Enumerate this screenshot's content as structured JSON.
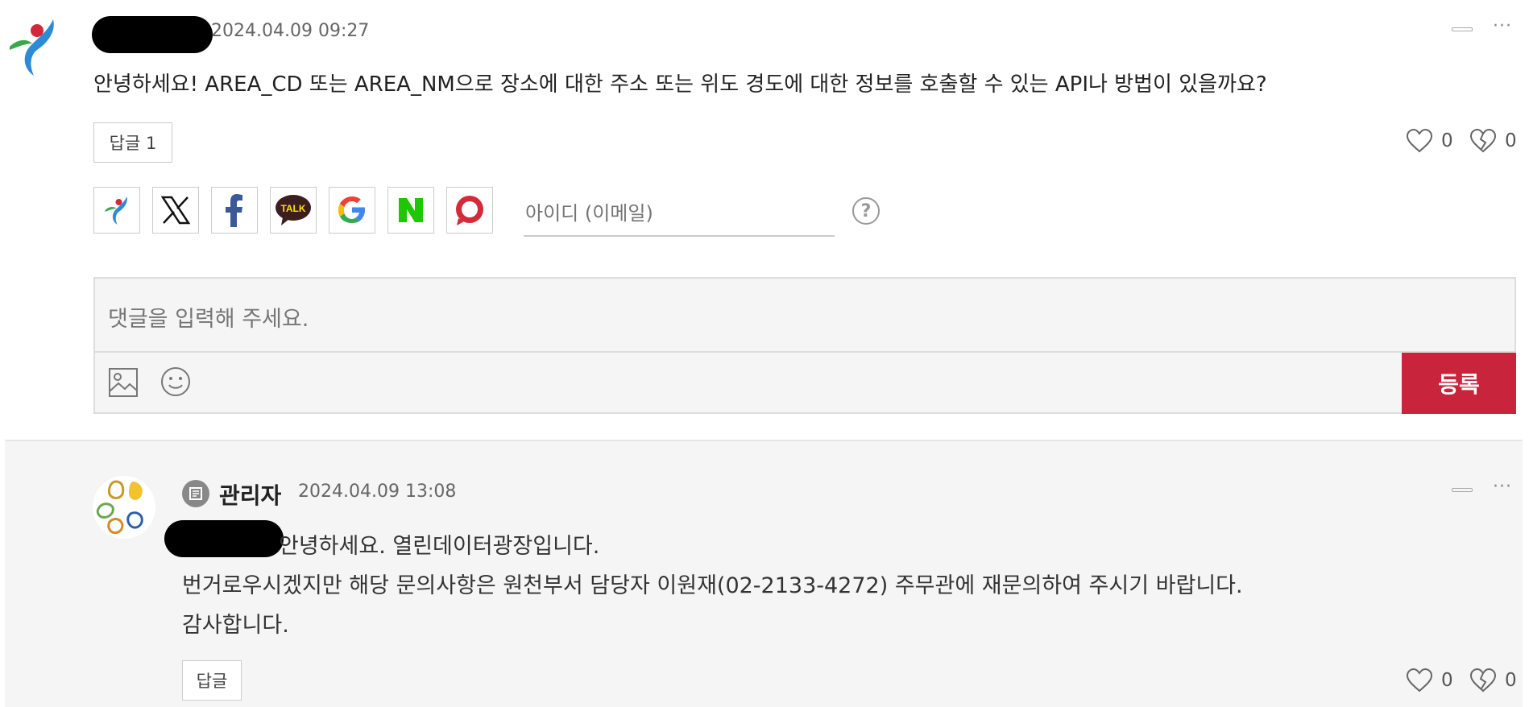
{
  "comment": {
    "timestamp": "2024.04.09 09:27",
    "text": "안녕하세요! AREA_CD 또는 AREA_NM으로 장소에 대한 주소 또는 위도 경도에 대한 정보를 호출할 수 있는 API나 방법이 있을까요?",
    "reply_button": "답글 1",
    "likes": "0",
    "dislikes": "0",
    "more": "···"
  },
  "login": {
    "social_icons": [
      "seoul-logo-icon",
      "x-icon",
      "facebook-icon",
      "kakaotalk-icon",
      "google-icon",
      "naver-icon",
      "other-login-icon"
    ],
    "talk_label": "TALK",
    "id_placeholder": "아이디 (이메일)",
    "help": "?"
  },
  "composer": {
    "placeholder": "댓글을 입력해 주세요.",
    "submit_label": "등록"
  },
  "reply": {
    "author": "관리자",
    "timestamp": "2024.04.09 13:08",
    "lines": [
      "안녕하세요. 열린데이터광장입니다.",
      "번거로우시겠지만 해당 문의사항은 원천부서 담당자 이원재(02-2133-4272) 주무관에 재문의하여 주시기 바랍니다.",
      "감사합니다."
    ],
    "reply_button": "답글",
    "likes": "0",
    "dislikes": "0",
    "more": "···"
  },
  "colors": {
    "accent": "#c8253c",
    "seoul_red": "#d4283a",
    "seoul_blue": "#2d8bd6",
    "seoul_green": "#3aa84a"
  }
}
